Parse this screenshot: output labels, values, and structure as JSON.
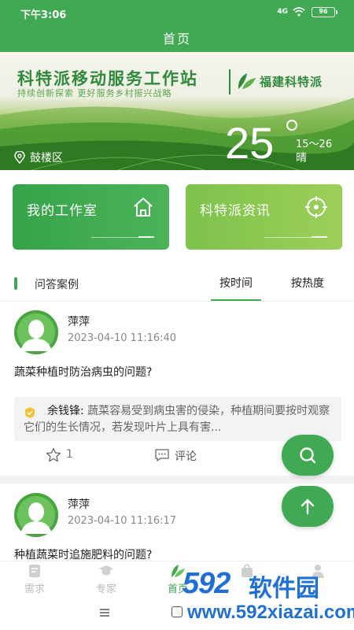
{
  "status_bar": {
    "time": "下午3:06",
    "signal": "4G",
    "battery": "96"
  },
  "header": {
    "title": "首页"
  },
  "banner": {
    "headline": "科特派移动服务工作站",
    "subline": "持续创新探索  更好服务乡村振兴战略",
    "brand": "福建科特派",
    "location": "鼓楼区",
    "temperature": "25",
    "temp_range": "15～26",
    "weather": "晴"
  },
  "cards": [
    {
      "label": "我的工作室",
      "icon": "home-icon"
    },
    {
      "label": "科特派资讯",
      "icon": "target-icon"
    }
  ],
  "section": {
    "title": "问答案例",
    "tabs": [
      "按时间",
      "按热度"
    ],
    "active_tab": "按时间"
  },
  "posts": [
    {
      "author": "萍萍",
      "date": "2023-04-10 11:16:40",
      "question": "蔬菜种植时防治病虫的问题?",
      "reply_author": "余钱锋:",
      "reply_text": "蔬菜容易受到病虫害的侵染，种植期间要按时观察它们的生长情况，若发现叶片上具有害...",
      "likes": "1",
      "comment_label": "评论"
    },
    {
      "author": "萍萍",
      "date": "2023-04-10 11:16:17",
      "question": "种植蔬菜时追施肥料的问题?"
    }
  ],
  "nav": [
    {
      "label": "需求",
      "icon": "request-icon"
    },
    {
      "label": "专家",
      "icon": "expert-icon"
    },
    {
      "label": "首页",
      "icon": "leaf-icon"
    },
    {
      "label": "",
      "icon": "bag-icon"
    },
    {
      "label": "",
      "icon": "user-icon"
    }
  ],
  "watermark": {
    "line1": "592",
    "line2": "软件园",
    "line3": "www.592xiazai.com"
  },
  "colors": {
    "primary": "#3faa52",
    "accent_light": "#8ccc55",
    "watermark": "#1e6fd6"
  }
}
